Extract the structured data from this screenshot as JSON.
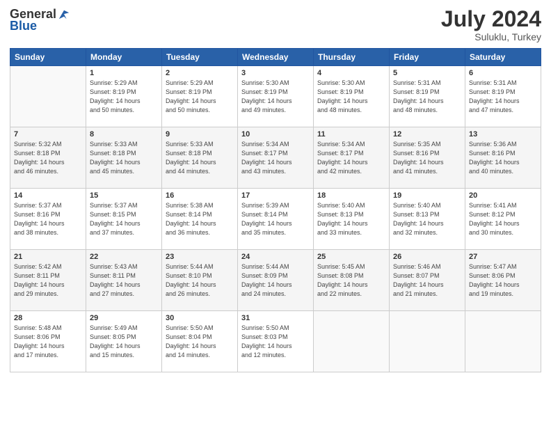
{
  "logo": {
    "general": "General",
    "blue": "Blue"
  },
  "title": "July 2024",
  "location": "Suluklu, Turkey",
  "weekdays": [
    "Sunday",
    "Monday",
    "Tuesday",
    "Wednesday",
    "Thursday",
    "Friday",
    "Saturday"
  ],
  "weeks": [
    [
      {
        "day": "",
        "sunrise": "",
        "sunset": "",
        "daylight": ""
      },
      {
        "day": "1",
        "sunrise": "Sunrise: 5:29 AM",
        "sunset": "Sunset: 8:19 PM",
        "daylight": "Daylight: 14 hours and 50 minutes."
      },
      {
        "day": "2",
        "sunrise": "Sunrise: 5:29 AM",
        "sunset": "Sunset: 8:19 PM",
        "daylight": "Daylight: 14 hours and 50 minutes."
      },
      {
        "day": "3",
        "sunrise": "Sunrise: 5:30 AM",
        "sunset": "Sunset: 8:19 PM",
        "daylight": "Daylight: 14 hours and 49 minutes."
      },
      {
        "day": "4",
        "sunrise": "Sunrise: 5:30 AM",
        "sunset": "Sunset: 8:19 PM",
        "daylight": "Daylight: 14 hours and 48 minutes."
      },
      {
        "day": "5",
        "sunrise": "Sunrise: 5:31 AM",
        "sunset": "Sunset: 8:19 PM",
        "daylight": "Daylight: 14 hours and 48 minutes."
      },
      {
        "day": "6",
        "sunrise": "Sunrise: 5:31 AM",
        "sunset": "Sunset: 8:19 PM",
        "daylight": "Daylight: 14 hours and 47 minutes."
      }
    ],
    [
      {
        "day": "7",
        "sunrise": "Sunrise: 5:32 AM",
        "sunset": "Sunset: 8:18 PM",
        "daylight": "Daylight: 14 hours and 46 minutes."
      },
      {
        "day": "8",
        "sunrise": "Sunrise: 5:33 AM",
        "sunset": "Sunset: 8:18 PM",
        "daylight": "Daylight: 14 hours and 45 minutes."
      },
      {
        "day": "9",
        "sunrise": "Sunrise: 5:33 AM",
        "sunset": "Sunset: 8:18 PM",
        "daylight": "Daylight: 14 hours and 44 minutes."
      },
      {
        "day": "10",
        "sunrise": "Sunrise: 5:34 AM",
        "sunset": "Sunset: 8:17 PM",
        "daylight": "Daylight: 14 hours and 43 minutes."
      },
      {
        "day": "11",
        "sunrise": "Sunrise: 5:34 AM",
        "sunset": "Sunset: 8:17 PM",
        "daylight": "Daylight: 14 hours and 42 minutes."
      },
      {
        "day": "12",
        "sunrise": "Sunrise: 5:35 AM",
        "sunset": "Sunset: 8:16 PM",
        "daylight": "Daylight: 14 hours and 41 minutes."
      },
      {
        "day": "13",
        "sunrise": "Sunrise: 5:36 AM",
        "sunset": "Sunset: 8:16 PM",
        "daylight": "Daylight: 14 hours and 40 minutes."
      }
    ],
    [
      {
        "day": "14",
        "sunrise": "Sunrise: 5:37 AM",
        "sunset": "Sunset: 8:16 PM",
        "daylight": "Daylight: 14 hours and 38 minutes."
      },
      {
        "day": "15",
        "sunrise": "Sunrise: 5:37 AM",
        "sunset": "Sunset: 8:15 PM",
        "daylight": "Daylight: 14 hours and 37 minutes."
      },
      {
        "day": "16",
        "sunrise": "Sunrise: 5:38 AM",
        "sunset": "Sunset: 8:14 PM",
        "daylight": "Daylight: 14 hours and 36 minutes."
      },
      {
        "day": "17",
        "sunrise": "Sunrise: 5:39 AM",
        "sunset": "Sunset: 8:14 PM",
        "daylight": "Daylight: 14 hours and 35 minutes."
      },
      {
        "day": "18",
        "sunrise": "Sunrise: 5:40 AM",
        "sunset": "Sunset: 8:13 PM",
        "daylight": "Daylight: 14 hours and 33 minutes."
      },
      {
        "day": "19",
        "sunrise": "Sunrise: 5:40 AM",
        "sunset": "Sunset: 8:13 PM",
        "daylight": "Daylight: 14 hours and 32 minutes."
      },
      {
        "day": "20",
        "sunrise": "Sunrise: 5:41 AM",
        "sunset": "Sunset: 8:12 PM",
        "daylight": "Daylight: 14 hours and 30 minutes."
      }
    ],
    [
      {
        "day": "21",
        "sunrise": "Sunrise: 5:42 AM",
        "sunset": "Sunset: 8:11 PM",
        "daylight": "Daylight: 14 hours and 29 minutes."
      },
      {
        "day": "22",
        "sunrise": "Sunrise: 5:43 AM",
        "sunset": "Sunset: 8:11 PM",
        "daylight": "Daylight: 14 hours and 27 minutes."
      },
      {
        "day": "23",
        "sunrise": "Sunrise: 5:44 AM",
        "sunset": "Sunset: 8:10 PM",
        "daylight": "Daylight: 14 hours and 26 minutes."
      },
      {
        "day": "24",
        "sunrise": "Sunrise: 5:44 AM",
        "sunset": "Sunset: 8:09 PM",
        "daylight": "Daylight: 14 hours and 24 minutes."
      },
      {
        "day": "25",
        "sunrise": "Sunrise: 5:45 AM",
        "sunset": "Sunset: 8:08 PM",
        "daylight": "Daylight: 14 hours and 22 minutes."
      },
      {
        "day": "26",
        "sunrise": "Sunrise: 5:46 AM",
        "sunset": "Sunset: 8:07 PM",
        "daylight": "Daylight: 14 hours and 21 minutes."
      },
      {
        "day": "27",
        "sunrise": "Sunrise: 5:47 AM",
        "sunset": "Sunset: 8:06 PM",
        "daylight": "Daylight: 14 hours and 19 minutes."
      }
    ],
    [
      {
        "day": "28",
        "sunrise": "Sunrise: 5:48 AM",
        "sunset": "Sunset: 8:06 PM",
        "daylight": "Daylight: 14 hours and 17 minutes."
      },
      {
        "day": "29",
        "sunrise": "Sunrise: 5:49 AM",
        "sunset": "Sunset: 8:05 PM",
        "daylight": "Daylight: 14 hours and 15 minutes."
      },
      {
        "day": "30",
        "sunrise": "Sunrise: 5:50 AM",
        "sunset": "Sunset: 8:04 PM",
        "daylight": "Daylight: 14 hours and 14 minutes."
      },
      {
        "day": "31",
        "sunrise": "Sunrise: 5:50 AM",
        "sunset": "Sunset: 8:03 PM",
        "daylight": "Daylight: 14 hours and 12 minutes."
      },
      {
        "day": "",
        "sunrise": "",
        "sunset": "",
        "daylight": ""
      },
      {
        "day": "",
        "sunrise": "",
        "sunset": "",
        "daylight": ""
      },
      {
        "day": "",
        "sunrise": "",
        "sunset": "",
        "daylight": ""
      }
    ]
  ]
}
